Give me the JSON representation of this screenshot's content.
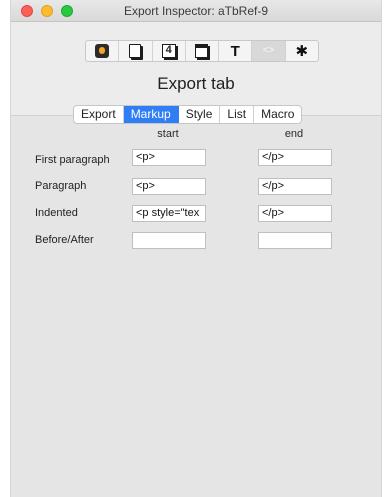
{
  "window": {
    "title": "Export Inspector: aTbRef-9"
  },
  "toolbar": {
    "buttons": [
      {
        "icon": "export-icon",
        "selected": false
      },
      {
        "icon": "page-icon",
        "selected": false
      },
      {
        "icon": "number-icon",
        "glyph": "4",
        "selected": false
      },
      {
        "icon": "block-icon",
        "selected": false
      },
      {
        "icon": "text-icon",
        "glyph": "T",
        "selected": false
      },
      {
        "icon": "code-icon",
        "glyph": "<>",
        "selected": true
      },
      {
        "icon": "gear-icon",
        "glyph": "✱",
        "selected": false
      }
    ]
  },
  "section": {
    "title": "Export tab"
  },
  "tabs": {
    "items": [
      "Export",
      "Markup",
      "Style",
      "List",
      "Macro"
    ],
    "active": "Markup",
    "accent_color": "#2f7ef6"
  },
  "columns": {
    "start": "start",
    "end": "end"
  },
  "rows": [
    {
      "label": "First paragraph",
      "start": "<p>",
      "end": "</p>"
    },
    {
      "label": "Paragraph",
      "start": "<p>",
      "end": "</p>"
    },
    {
      "label": "Indented",
      "start": "<p style=\"tex",
      "end": "</p>"
    },
    {
      "label": "Before/After",
      "start": "",
      "end": ""
    }
  ]
}
